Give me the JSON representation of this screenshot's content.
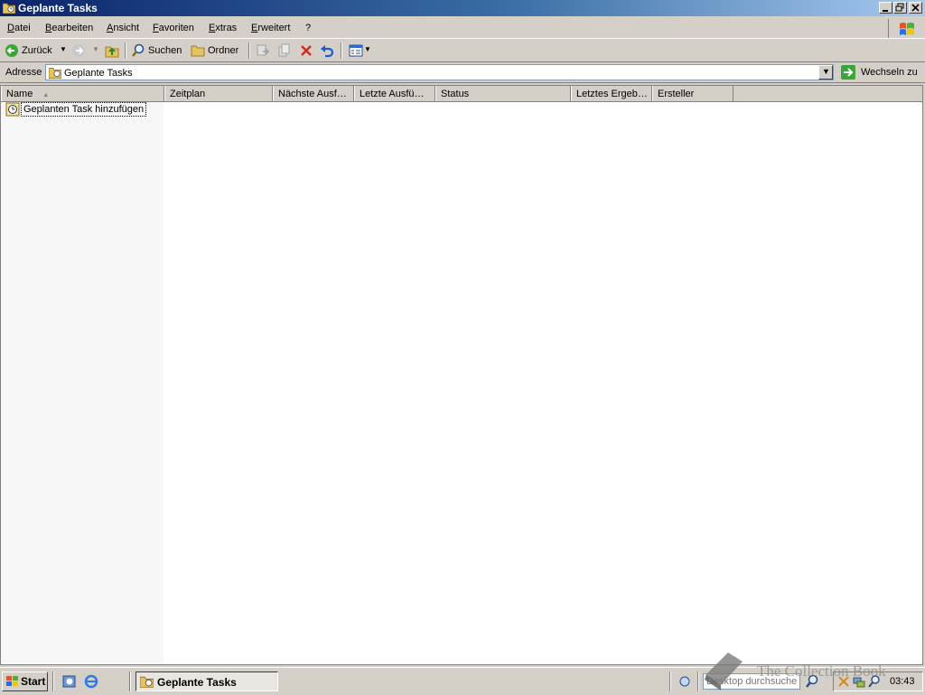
{
  "window": {
    "title": "Geplante Tasks"
  },
  "menu": [
    "Datei",
    "Bearbeiten",
    "Ansicht",
    "Favoriten",
    "Extras",
    "Erweitert",
    "?"
  ],
  "toolbar": {
    "back_label": "Zurück",
    "search_label": "Suchen",
    "folders_label": "Ordner"
  },
  "address": {
    "label": "Adresse",
    "value": "Geplante Tasks",
    "go_label": "Wechseln zu"
  },
  "columns": [
    "Name",
    "Zeitplan",
    "Nächste Ausf…",
    "Letzte Ausfü…",
    "Status",
    "Letztes Ergeb…",
    "Ersteller"
  ],
  "items": [
    {
      "label": "Geplanten Task hinzufügen"
    }
  ],
  "taskbar": {
    "start_label": "Start",
    "task_button_label": "Geplante Tasks",
    "search_placeholder": "Desktop durchsuchen",
    "clock": "03:43"
  },
  "watermark": "The Collection Book",
  "colors": {
    "title_start": "#0a246a",
    "title_end": "#a6caf0",
    "face": "#d4d0c8",
    "go_green": "#3aa53a"
  },
  "icons": [
    "folder-clock-icon",
    "minimize-icon",
    "restore-icon",
    "close-icon",
    "windows-flag-icon",
    "back-arrow-icon",
    "forward-arrow-icon",
    "up-folder-icon",
    "search-icon",
    "folders-icon",
    "move-to-icon",
    "copy-to-icon",
    "delete-icon",
    "undo-icon",
    "views-icon",
    "go-arrow-icon",
    "task-wizard-icon",
    "quick-launch-icon",
    "ie-icon"
  ]
}
